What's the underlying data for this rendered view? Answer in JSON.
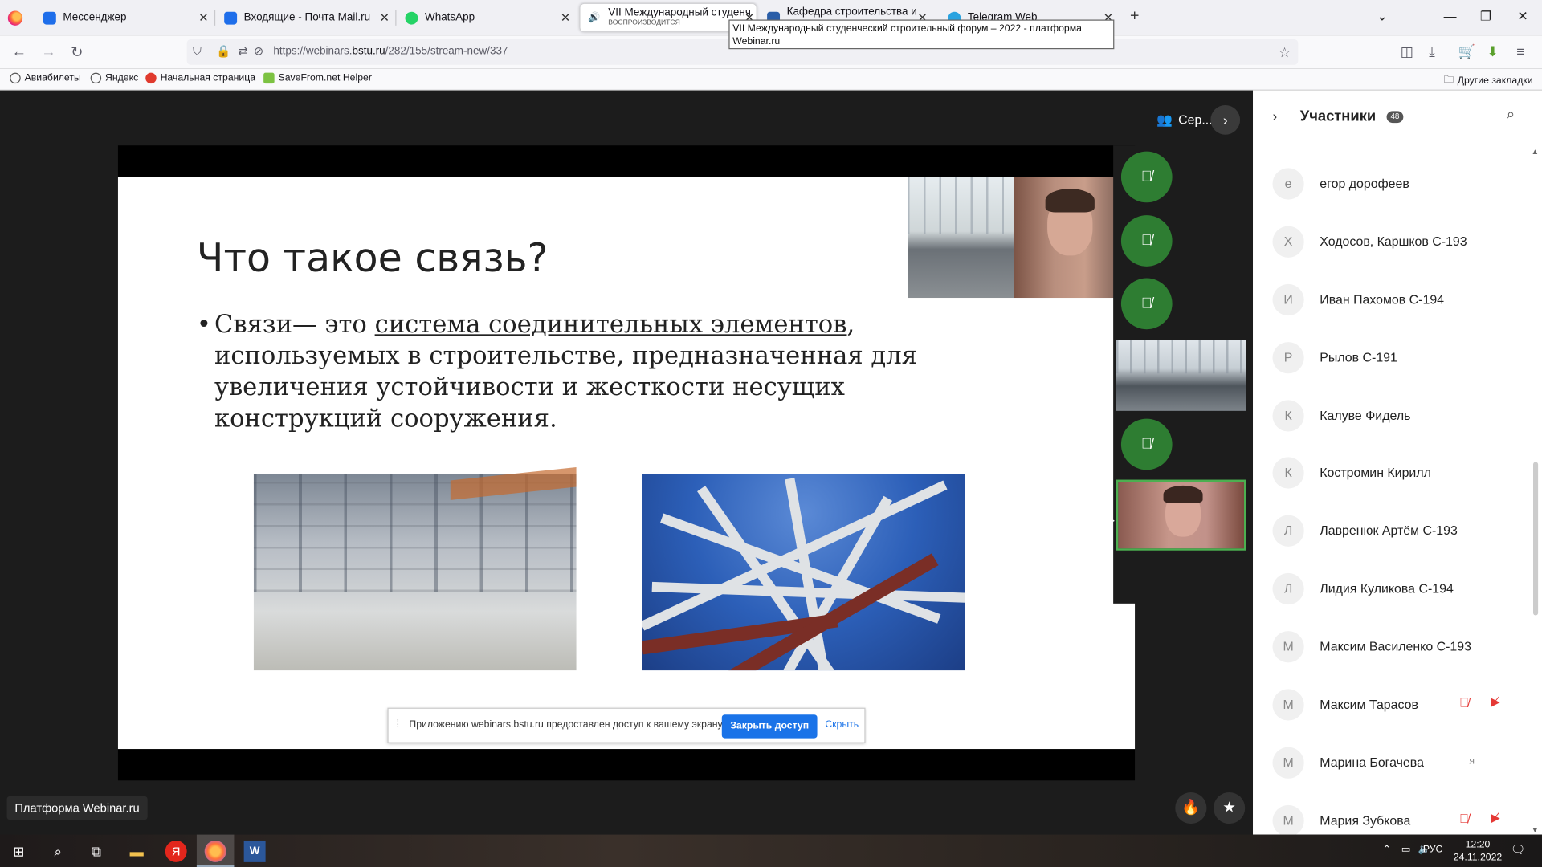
{
  "browser": {
    "tabs": [
      {
        "title": "Мессенджер",
        "icon_color": "#1e6eea"
      },
      {
        "title": "Входящие - Почта Mail.ru",
        "icon_color": "#1e6eea"
      },
      {
        "title": "WhatsApp",
        "icon_color": "#25d366"
      },
      {
        "title": "VII Международный студенч",
        "subtitle": "ВОСПРОИЗВОДИТСЯ",
        "active": true
      },
      {
        "title": "Кафедра строительства и гор",
        "icon_color": "#2a5ea8"
      },
      {
        "title": "Telegram Web",
        "icon_color": "#2aa3e0"
      }
    ],
    "tooltip": "VII Международный студенческий строительный форум – 2022 - платформа Webinar.ru",
    "url_prefix": "https://webinars.",
    "url_host": "bstu.ru",
    "url_path": "/282/155/stream-new/337",
    "bookmarks": [
      "Авиабилеты",
      "Яндекс",
      "Начальная страница",
      "SaveFrom.net Helper"
    ],
    "other_bookmarks": "Другие закладки"
  },
  "webinar": {
    "presenter_label": "Сер...",
    "slide": {
      "title": "Что такое связь?",
      "text_before": "Связи— это ",
      "text_link": "система соединительных элементов",
      "text_after": ", используемых в строительстве, предназначенная для увеличения устойчивости и жесткости несущих конструкций сооружения."
    },
    "share_banner": {
      "message": "Приложению webinars.bstu.ru предоставлен доступ к вашему экрану.",
      "stop_label": "Закрыть доступ",
      "hide_label": "Скрыть"
    },
    "platform_label": "Платформа Webinar.ru"
  },
  "participants": {
    "title": "Участники",
    "count": "48",
    "items": [
      {
        "initial": "е",
        "name": "егор дорофеев"
      },
      {
        "initial": "Х",
        "name": "Ходосов, Каршков С-193"
      },
      {
        "initial": "И",
        "name": "Иван Пахомов С-194"
      },
      {
        "initial": "Р",
        "name": "Рылов С-191"
      },
      {
        "initial": "К",
        "name": "Калуве Фидель"
      },
      {
        "initial": "К",
        "name": "Костромин Кирилл"
      },
      {
        "initial": "Л",
        "name": "Лавренюк Артём С-193"
      },
      {
        "initial": "Л",
        "name": "Лидия Куликова С-194"
      },
      {
        "initial": "М",
        "name": "Максим Василенко С-193"
      },
      {
        "initial": "М",
        "name": "Максим Тарасов",
        "muted": true
      },
      {
        "initial": "М",
        "name": "Марина Богачева",
        "tag": "я"
      },
      {
        "initial": "М",
        "name": "Мария Зубкова",
        "muted": true
      }
    ]
  },
  "taskbar": {
    "lang": "РУС",
    "time": "12:20",
    "date": "24.11.2022"
  }
}
